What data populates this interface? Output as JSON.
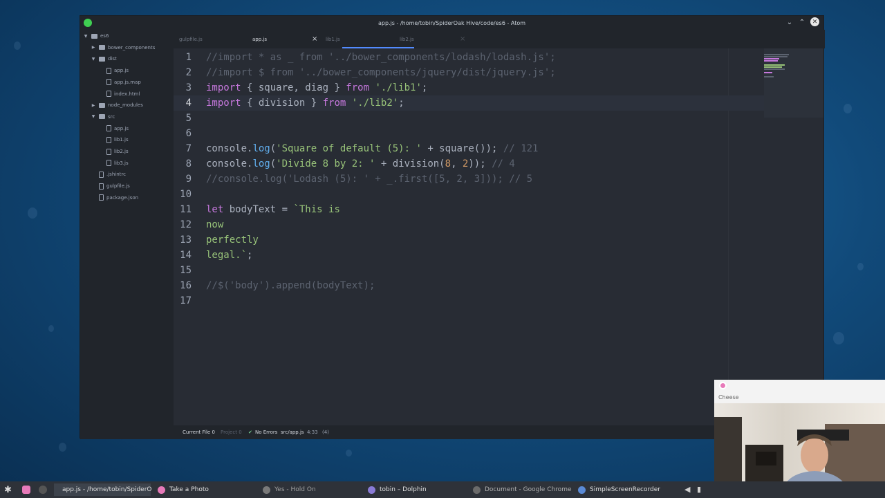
{
  "window": {
    "title": "app.js - /home/tobin/SpiderOak Hive/code/es6 - Atom",
    "controls": [
      "⌄",
      "⌃",
      "✕"
    ]
  },
  "tree": {
    "items": [
      {
        "label": "es6",
        "type": "folder",
        "expanded": true
      },
      {
        "label": "bower_components",
        "type": "folder",
        "expanded": false
      },
      {
        "label": "dist",
        "type": "folder",
        "expanded": true
      },
      {
        "label": "app.js",
        "type": "file"
      },
      {
        "label": "app.js.map",
        "type": "file"
      },
      {
        "label": "index.html",
        "type": "file"
      },
      {
        "label": "node_modules",
        "type": "folder",
        "expanded": false
      },
      {
        "label": "src",
        "type": "folder",
        "expanded": true
      },
      {
        "label": "app.js",
        "type": "file"
      },
      {
        "label": "lib1.js",
        "type": "file"
      },
      {
        "label": "lib2.js",
        "type": "file"
      },
      {
        "label": "lib3.js",
        "type": "file"
      },
      {
        "label": ".jshintrc",
        "type": "file"
      },
      {
        "label": "gulpfile.js",
        "type": "file"
      },
      {
        "label": "package.json",
        "type": "file"
      }
    ]
  },
  "tabs": [
    {
      "label": "gulpfile.js",
      "active": false
    },
    {
      "label": "app.js",
      "active": true
    },
    {
      "label": "lib1.js",
      "active": false
    },
    {
      "label": "lib2.js",
      "active": false
    }
  ],
  "editor": {
    "cursor_line": 4,
    "lines": [
      {
        "n": "1",
        "tokens": [
          {
            "c": "t-cmt",
            "t": "//import * as _ from '../bower_components/lodash/lodash.js';"
          }
        ]
      },
      {
        "n": "2",
        "tokens": [
          {
            "c": "t-cmt",
            "t": "//import $ from '../bower_components/jquery/dist/jquery.js';"
          }
        ]
      },
      {
        "n": "3",
        "tokens": [
          {
            "c": "t-kw",
            "t": "import"
          },
          {
            "c": "t-txt",
            "t": " { square, diag } "
          },
          {
            "c": "t-kw",
            "t": "from"
          },
          {
            "c": "t-txt",
            "t": " "
          },
          {
            "c": "t-str",
            "t": "'./lib1'"
          },
          {
            "c": "t-txt",
            "t": ";"
          }
        ]
      },
      {
        "n": "4",
        "tokens": [
          {
            "c": "t-kw",
            "t": "import"
          },
          {
            "c": "t-txt",
            "t": " { division } "
          },
          {
            "c": "t-kw",
            "t": "from"
          },
          {
            "c": "t-txt",
            "t": " "
          },
          {
            "c": "t-str",
            "t": "'./lib2'"
          },
          {
            "c": "t-txt",
            "t": ";"
          }
        ]
      },
      {
        "n": "5",
        "tokens": []
      },
      {
        "n": "6",
        "tokens": []
      },
      {
        "n": "7",
        "tokens": [
          {
            "c": "t-txt",
            "t": "console."
          },
          {
            "c": "t-fn",
            "t": "log"
          },
          {
            "c": "t-txt",
            "t": "("
          },
          {
            "c": "t-str",
            "t": "'Square of default (5): '"
          },
          {
            "c": "t-txt",
            "t": " + square()); "
          },
          {
            "c": "t-cmt",
            "t": "// 121"
          }
        ]
      },
      {
        "n": "8",
        "tokens": [
          {
            "c": "t-txt",
            "t": "console."
          },
          {
            "c": "t-fn",
            "t": "log"
          },
          {
            "c": "t-txt",
            "t": "("
          },
          {
            "c": "t-str",
            "t": "'Divide 8 by 2: '"
          },
          {
            "c": "t-txt",
            "t": " + division("
          },
          {
            "c": "t-num",
            "t": "8"
          },
          {
            "c": "t-txt",
            "t": ", "
          },
          {
            "c": "t-num",
            "t": "2"
          },
          {
            "c": "t-txt",
            "t": ")); "
          },
          {
            "c": "t-cmt",
            "t": "// 4"
          }
        ]
      },
      {
        "n": "9",
        "tokens": [
          {
            "c": "t-cmt",
            "t": "//console.log('Lodash (5): ' + _.first([5, 2, 3])); // 5"
          }
        ]
      },
      {
        "n": "10",
        "tokens": []
      },
      {
        "n": "11",
        "tokens": [
          {
            "c": "t-kw",
            "t": "let"
          },
          {
            "c": "t-txt",
            "t": " bodyText = "
          },
          {
            "c": "t-str",
            "t": "`This is"
          }
        ]
      },
      {
        "n": "12",
        "tokens": [
          {
            "c": "t-str",
            "t": "now"
          }
        ]
      },
      {
        "n": "13",
        "tokens": [
          {
            "c": "t-str",
            "t": "perfectly"
          }
        ]
      },
      {
        "n": "14",
        "tokens": [
          {
            "c": "t-str",
            "t": "legal.`"
          },
          {
            "c": "t-txt",
            "t": ";"
          }
        ]
      },
      {
        "n": "15",
        "tokens": []
      },
      {
        "n": "16",
        "tokens": [
          {
            "c": "t-cmt",
            "t": "//$('body').append(bodyText);"
          }
        ]
      },
      {
        "n": "17",
        "tokens": []
      }
    ]
  },
  "statusbar": {
    "current_file": "Current File",
    "current_file_count": "0",
    "project": "Project",
    "project_count": "0",
    "errors": "No Errors",
    "path": "src/app.js",
    "position": "4:33",
    "selection": "(4)"
  },
  "taskbar": {
    "items": [
      {
        "label": "app.js - /home/tobin/SpiderO",
        "active": true
      },
      {
        "label": "Take a Photo",
        "active": false
      },
      {
        "label": "Yes - Hold On",
        "active": false
      },
      {
        "label": "tobin – Dolphin",
        "active": false
      },
      {
        "label": "Document - Google Chrome",
        "active": false
      },
      {
        "label": "SimpleScreenRecorder",
        "active": false
      }
    ]
  },
  "cheese": {
    "title": "Cheese"
  },
  "colors": {
    "atom_bg": "#282c34",
    "panel_bg": "#21252b",
    "accent": "#528bff",
    "success": "#73c990"
  }
}
